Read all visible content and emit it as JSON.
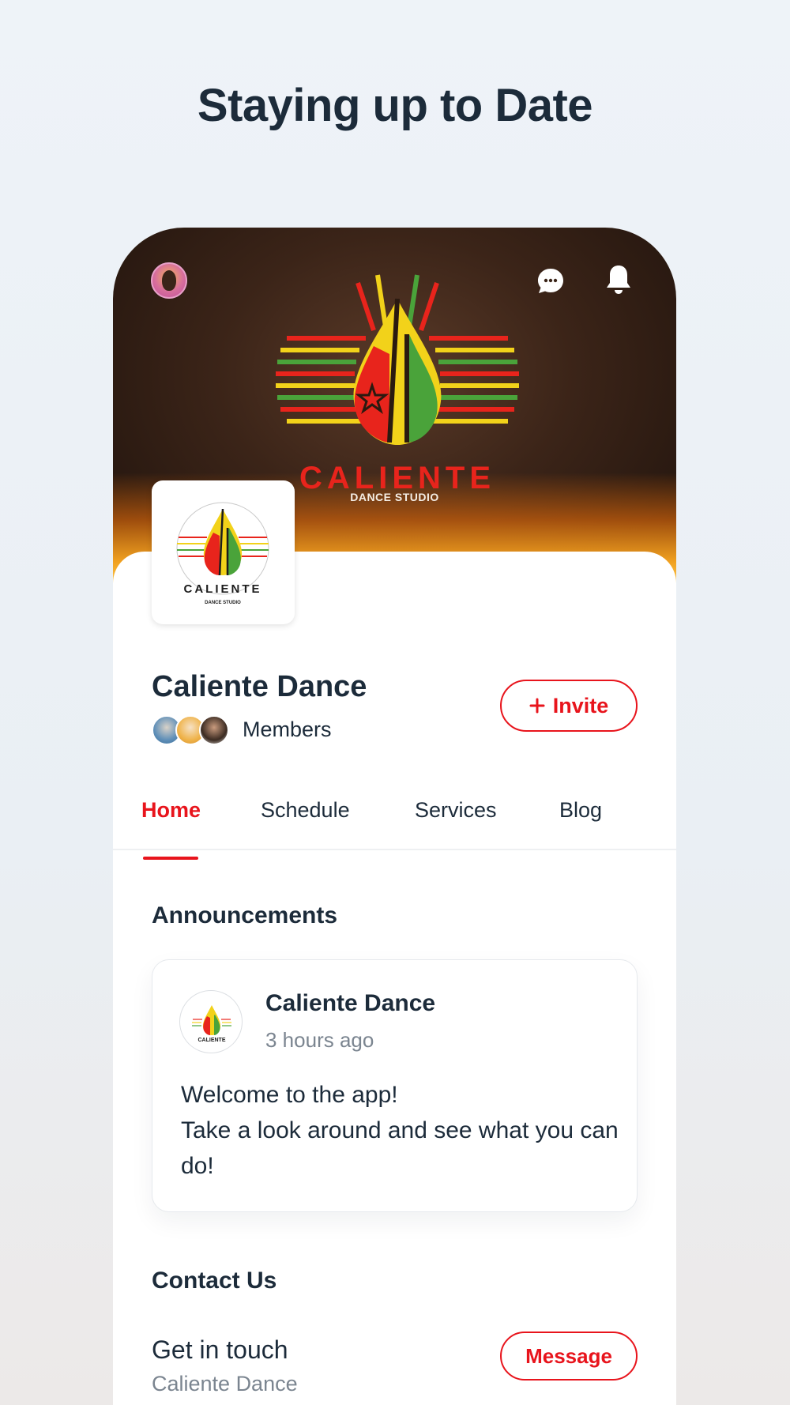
{
  "headline": "Staying up to Date",
  "cover": {
    "logo_word": "CALIENTE",
    "logo_sub": "DANCE STUDIO"
  },
  "top_bar": {
    "icons": [
      "user-avatar",
      "chat-icon",
      "bell-icon"
    ]
  },
  "group": {
    "name": "Caliente Dance",
    "members_label": "Members",
    "invite_label": "Invite",
    "invite_icon": "plus-icon"
  },
  "tabs": [
    {
      "label": "Home",
      "active": true
    },
    {
      "label": "Schedule",
      "active": false
    },
    {
      "label": "Services",
      "active": false
    },
    {
      "label": "Blog",
      "active": false
    }
  ],
  "announcements": {
    "title": "Announcements",
    "post": {
      "author": "Caliente Dance",
      "time": "3 hours ago",
      "line1": "Welcome to the app!",
      "line2": "Take a look around and see what you can do!"
    }
  },
  "contact": {
    "title": "Contact Us",
    "heading": "Get in touch",
    "subtitle": "Caliente Dance",
    "message_label": "Message"
  },
  "colors": {
    "accent": "#e8141c",
    "text": "#1c2b3a",
    "muted": "#7b8590"
  }
}
